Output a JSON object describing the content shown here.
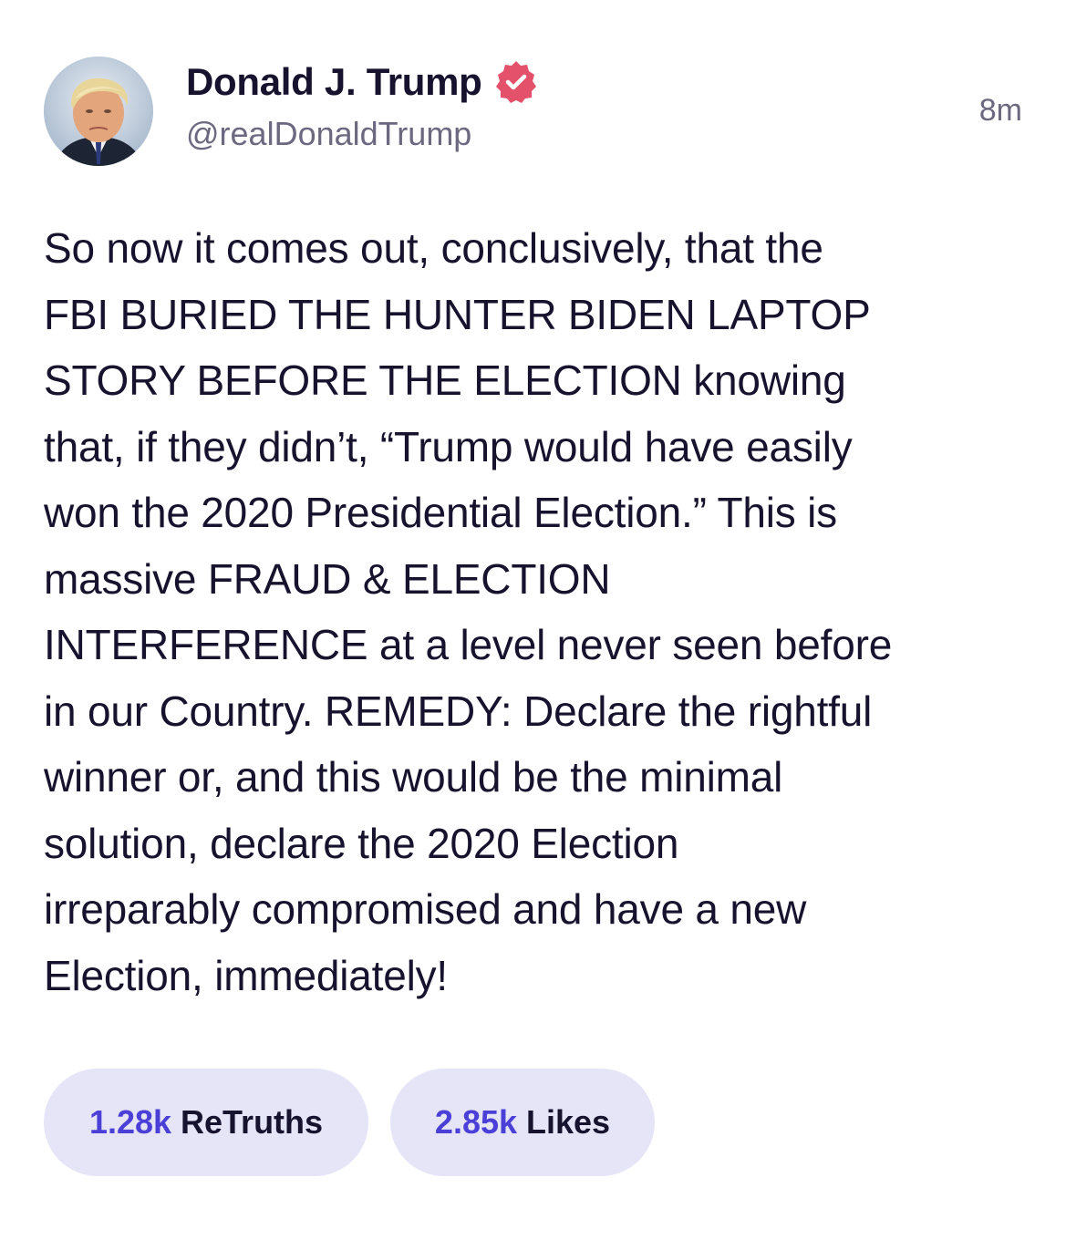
{
  "author": {
    "display_name": "Donald J. Trump",
    "handle": "@realDonaldTrump",
    "avatar_icon": "profile-photo",
    "verified_icon": "verified-badge-icon",
    "verified_color": "#e3516a"
  },
  "post": {
    "timestamp": "8m",
    "lines": [
      "So now it comes out, conclusively, that the",
      "FBI BURIED THE HUNTER BIDEN LAPTOP",
      "STORY BEFORE THE ELECTION knowing",
      "that, if they didn’t, “Trump would have easily",
      "won the 2020 Presidential Election.” This is",
      "massive FRAUD & ELECTION",
      "INTERFERENCE at a level never seen before",
      "in our Country. REMEDY: Declare the rightful",
      "winner or, and this would be the minimal",
      "solution, declare the 2020 Election",
      "irreparably compromised and have a new",
      "Election, immediately!"
    ]
  },
  "stats": {
    "retruths": {
      "count": "1.28k",
      "label": "ReTruths"
    },
    "likes": {
      "count": "2.85k",
      "label": "Likes"
    }
  },
  "colors": {
    "accent": "#4a3fd6",
    "pill_background": "#e6e4f7",
    "text": "#17132e",
    "muted": "#6b6880"
  }
}
